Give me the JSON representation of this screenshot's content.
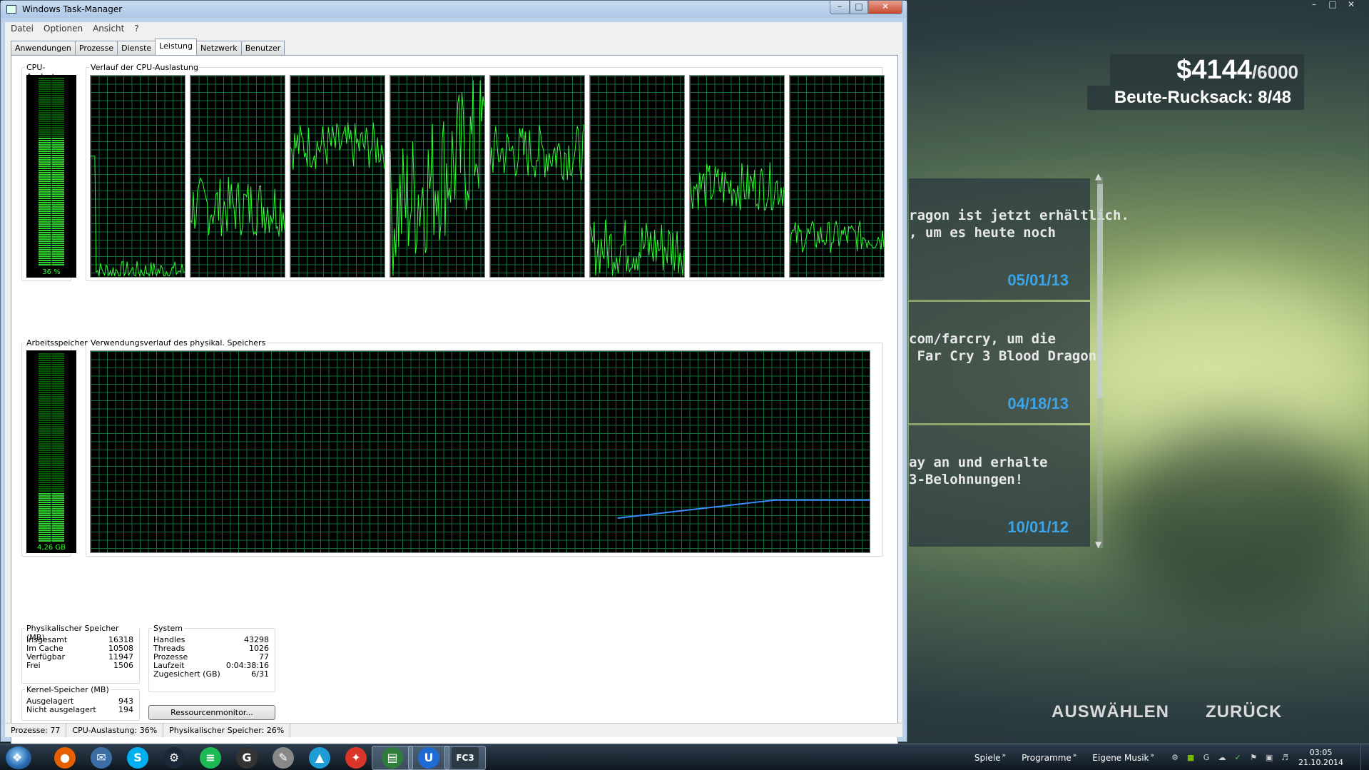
{
  "game": {
    "money": "$4144",
    "money_max": "/6000",
    "loot": "Beute-Rucksack: 8/48",
    "news": [
      {
        "text": "ragon ist jetzt erhältlich.\n, um es heute noch",
        "date": "05/01/13"
      },
      {
        "text": "com/farcry, um die\n Far Cry 3 Blood Dragon",
        "date": "04/18/13"
      },
      {
        "text": "ay an und erhalte\n3-Belohnungen!",
        "date": "10/01/12"
      }
    ],
    "btn_select": "AUSWÄHLEN",
    "btn_back": "ZURÜCK"
  },
  "taskmanager": {
    "title": "Windows Task-Manager",
    "menu": [
      "Datei",
      "Optionen",
      "Ansicht",
      "?"
    ],
    "tabs": [
      "Anwendungen",
      "Prozesse",
      "Dienste",
      "Leistung",
      "Netzwerk",
      "Benutzer"
    ],
    "active_tab": "Leistung",
    "cpu_label": "CPU-Auslastung",
    "cpu_value": "36 %",
    "cpu_fraction": 0.36,
    "cpu_history_label": "Verlauf der CPU-Auslastung",
    "mem_label": "Arbeitsspeicher",
    "mem_value": "4,26 GB",
    "mem_fraction": 0.26,
    "mem_history_label": "Verwendungsverlauf des physikal. Speichers",
    "physical": {
      "title": "Physikalischer Speicher (MB)",
      "rows": [
        [
          "Insgesamt",
          "16318"
        ],
        [
          "Im Cache",
          "10508"
        ],
        [
          "Verfügbar",
          "11947"
        ],
        [
          "Frei",
          "1506"
        ]
      ]
    },
    "kernel": {
      "title": "Kernel-Speicher (MB)",
      "rows": [
        [
          "Ausgelagert",
          "943"
        ],
        [
          "Nicht ausgelagert",
          "194"
        ]
      ]
    },
    "system": {
      "title": "System",
      "rows": [
        [
          "Handles",
          "43298"
        ],
        [
          "Threads",
          "1026"
        ],
        [
          "Prozesse",
          "77"
        ],
        [
          "Laufzeit",
          "0:04:38:16"
        ],
        [
          "Zugesichert (GB)",
          "6/31"
        ]
      ]
    },
    "resmon_button": "Ressourcenmonitor...",
    "status": [
      "Prozesse: 77",
      "CPU-Auslastung: 36%",
      "Physikalischer Speicher: 26%"
    ]
  },
  "taskbar": {
    "toolbars": [
      "Spiele",
      "Programme",
      "Eigene Musik"
    ],
    "time": "03:05",
    "date": "21.10.2014",
    "apps": [
      {
        "name": "firefox-icon",
        "glyph": "●",
        "color": "#e66000"
      },
      {
        "name": "thunderbird-icon",
        "glyph": "✉",
        "color": "#3a6ea5"
      },
      {
        "name": "skype-icon",
        "glyph": "S",
        "color": "#00aff0"
      },
      {
        "name": "steam-icon",
        "glyph": "⚙",
        "color": "#1b2838"
      },
      {
        "name": "spotify-icon",
        "glyph": "≡",
        "color": "#1db954"
      },
      {
        "name": "logitech-gaming-icon",
        "glyph": "G",
        "color": "#333333"
      },
      {
        "name": "notes-icon",
        "glyph": "✎",
        "color": "#888888"
      },
      {
        "name": "arrow-app-icon",
        "glyph": "▲",
        "color": "#1f9bd6"
      },
      {
        "name": "puzzle-app-icon",
        "glyph": "✦",
        "color": "#d9352b"
      },
      {
        "name": "taskmanager-icon",
        "glyph": "▤",
        "color": "#2f7d3d"
      },
      {
        "name": "uplay-icon",
        "glyph": "U",
        "color": "#1f6bd6"
      },
      {
        "name": "farcry3-icon",
        "glyph": "FC3",
        "color": "#2b3a44"
      }
    ]
  }
}
